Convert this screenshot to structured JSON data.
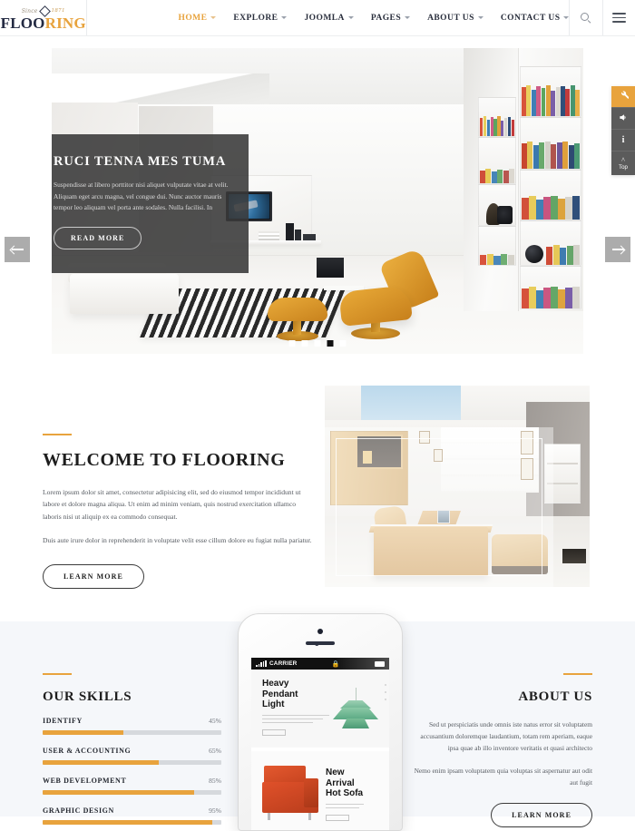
{
  "header": {
    "logo": {
      "since": "Since",
      "year": "1871",
      "word_dark": "FLOO",
      "word_accent": "RING",
      "diamond_icon": "diamond-icon"
    },
    "nav": [
      {
        "label": "HOME",
        "active": true
      },
      {
        "label": "EXPLORE",
        "active": false
      },
      {
        "label": "JOOMLA",
        "active": false
      },
      {
        "label": "PAGES",
        "active": false
      },
      {
        "label": "ABOUT US",
        "active": false
      },
      {
        "label": "CONTACT US",
        "active": false
      }
    ],
    "search_icon": "search-icon",
    "menu_icon": "hamburger-menu-icon"
  },
  "hero": {
    "title": "RUCI TENNA MES TUMA",
    "body": "Suspendisse at libero porttitor nisi aliquet vulputate vitae at velit. Aliquam eget arcu magna, vel congue dui. Nunc auctor mauris tempor leo aliquam vel porta ante sodales. Nulla facilisi. In",
    "button": "READ MORE",
    "prev_label": "Previous slide",
    "next_label": "Next slide",
    "slides_total": 5,
    "active_slide": 4
  },
  "rail": {
    "items": [
      {
        "name": "settings-wrench-icon",
        "glyph": "⚒",
        "accent": true
      },
      {
        "name": "megaphone-icon",
        "glyph": "📣",
        "accent": false
      },
      {
        "name": "info-icon",
        "glyph": "i",
        "accent": false
      }
    ],
    "top_label": "Top",
    "top_icon": "chevron-up-icon"
  },
  "welcome": {
    "title": "WELCOME TO FLOORING",
    "paragraph1": "Lorem ipsum dolor sit amet, consectetur adipisicing elit, sed do eiusmod tempor incididunt ut labore et dolore magna aliqua. Ut enim ad minim veniam, quis nostrud exercitation ullamco laboris nisi ut aliquip ex ea commodo consequat.",
    "paragraph2": "Duis aute irure dolor in reprehenderit in voluptate velit esse cillum dolore eu fugiat nulla pariatur.",
    "button": "LEARN MORE",
    "image_alt": "office-interior-photo"
  },
  "skills": {
    "title": "OUR SKILLS",
    "items": [
      {
        "label": "IDENTIFY",
        "percent": "45%",
        "value": 45
      },
      {
        "label": "USER & ACCOUNTING",
        "percent": "65%",
        "value": 65
      },
      {
        "label": "WEB DEVELOPMENT",
        "percent": "85%",
        "value": 85
      },
      {
        "label": "GRAPHIC DESIGN",
        "percent": "95%",
        "value": 95
      }
    ]
  },
  "about": {
    "title": "ABOUT US",
    "paragraph1": "Sed ut perspiciatis unde omnis iste natus error sit voluptatem accusantium doloremque laudantium, totam rem aperiam, eaque ipsa quae ab illo inventore veritatis et quasi architecto",
    "paragraph2": "Nemo enim ipsam voluptatem quia voluptas sit aspernatur aut odit aut fugit",
    "button": "LEARN MORE"
  },
  "phone": {
    "carrier": "CARRIER",
    "lock_icon": "lock-icon",
    "battery_icon": "battery-icon",
    "card1_title": "Heavy\nPendant\nLight",
    "card1_title_lines": [
      "Heavy",
      "Pendant",
      "Light"
    ],
    "card2_title_lines": [
      "New",
      "Arrival",
      "Hot Sofa"
    ]
  },
  "colors": {
    "accent": "#e8a33d",
    "logo_dark": "#232a42",
    "heading": "#1d1d1d",
    "body_text": "#555a60",
    "section_bg": "#f5f7fa",
    "caption_bg": "rgba(56,56,56,.88)",
    "rail_bg": "#5b5b5b",
    "track_bg": "#d6d9dd"
  }
}
